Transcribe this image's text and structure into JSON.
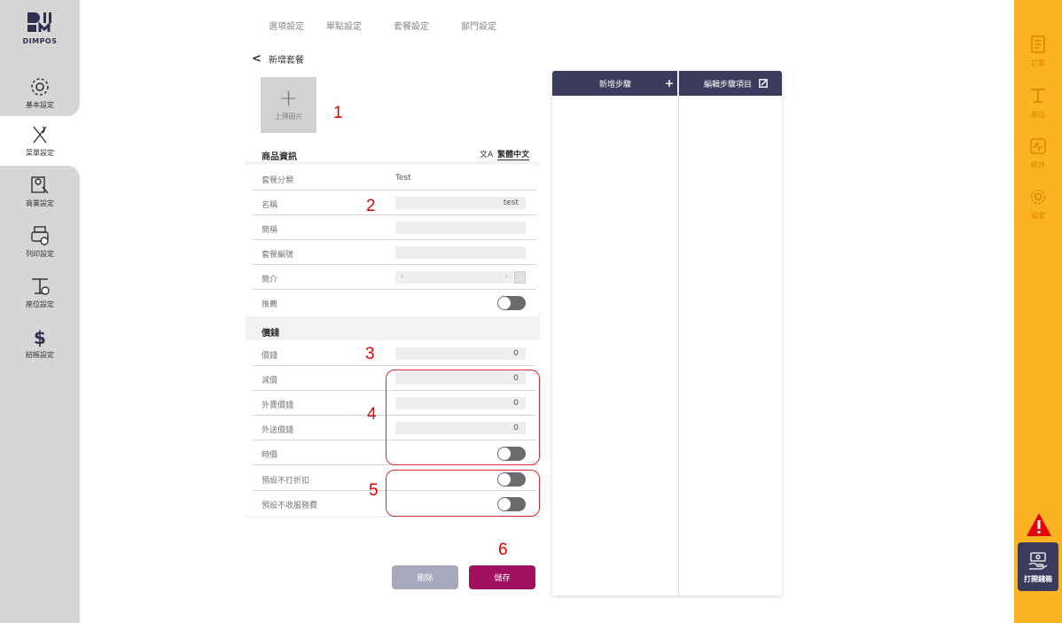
{
  "sidebar": {
    "logo_text": "DIMPOS",
    "items": [
      {
        "label": "基本設定",
        "icon": "gear-icon"
      },
      {
        "label": "菜單設定",
        "icon": "fork-knife-icon"
      },
      {
        "label": "商業設定",
        "icon": "menu-settings-icon"
      },
      {
        "label": "列印設定",
        "icon": "printer-icon"
      },
      {
        "label": "座位設定",
        "icon": "table-icon"
      },
      {
        "label": "結帳設定",
        "icon": "dollar-icon"
      }
    ]
  },
  "rightbar": {
    "items": [
      {
        "label": "訂單",
        "icon": "order-icon"
      },
      {
        "label": "座位",
        "icon": "table-icon"
      },
      {
        "label": "統計",
        "icon": "stats-icon"
      },
      {
        "label": "設定",
        "icon": "gear-icon"
      }
    ],
    "drawer_label": "打開錢箱"
  },
  "tabs": [
    "選項設定",
    "單點設定",
    "套餐設定",
    "部門設定"
  ],
  "header": {
    "back_label": "新增套餐"
  },
  "upload": {
    "label": "上傳圖片"
  },
  "product_info": {
    "title": "商品資訊",
    "language": "繁體中文",
    "rows": [
      {
        "key": "套餐分類",
        "value": "Test"
      },
      {
        "key": "名稱",
        "value": "test"
      },
      {
        "key": "簡稱",
        "value": ""
      },
      {
        "key": "套餐編號",
        "value": ""
      },
      {
        "key": "簡介",
        "value": ""
      },
      {
        "key": "推薦",
        "value": ""
      }
    ]
  },
  "price": {
    "title": "價錢",
    "rows": [
      {
        "key": "價錢",
        "value": "0"
      },
      {
        "key": "減價",
        "value": "0"
      },
      {
        "key": "外賣價錢",
        "value": "0"
      },
      {
        "key": "外送價錢",
        "value": "0"
      },
      {
        "key": "時價",
        "value": ""
      },
      {
        "key": "預設不打折扣",
        "value": ""
      },
      {
        "key": "預設不收服務費",
        "value": ""
      }
    ]
  },
  "annotations": [
    "1",
    "2",
    "3",
    "4",
    "5",
    "6"
  ],
  "buttons": {
    "delete": "刪除",
    "save": "儲存"
  },
  "steps": {
    "add_label": "新增步驟",
    "edit_label": "編輯步驟項目"
  },
  "colors": {
    "primary_dark": "#3b3b5e",
    "save": "#a0125f",
    "delete": "#a8a8bd",
    "accent": "#fbb321",
    "annotation": "#e30000"
  }
}
